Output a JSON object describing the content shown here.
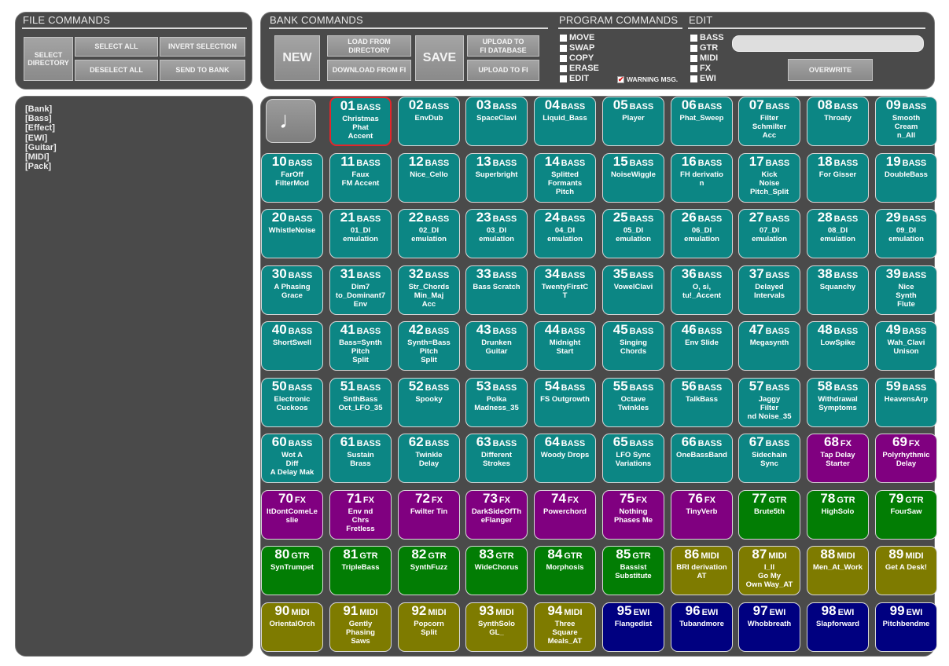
{
  "file_commands": {
    "title": "FILE COMMANDS",
    "select_directory": "SELECT\nDIRECTORY",
    "select_all": "SELECT ALL",
    "invert_selection": "INVERT SELECTION",
    "deselect_all": "DESELECT ALL",
    "send_to_bank": "SEND TO BANK"
  },
  "bank_commands": {
    "title": "BANK COMMANDS",
    "new": "NEW",
    "load_from_directory": "LOAD FROM\nDIRECTORY",
    "download_from_fi": "DOWNLOAD FROM FI",
    "save": "SAVE",
    "upload_to_fi_database": "UPLOAD TO\nFI DATABASE",
    "upload_to_fi": "UPLOAD TO FI"
  },
  "program_commands": {
    "title": "PROGRAM COMMANDS",
    "options": [
      "MOVE",
      "SWAP",
      "COPY",
      "ERASE",
      "EDIT"
    ],
    "warning_label": "WARNING MSG.",
    "warning_checked": true
  },
  "edit": {
    "title": "EDIT",
    "options": [
      "BASS",
      "GTR",
      "MIDI",
      "FX",
      "EWI"
    ],
    "text_value": "",
    "overwrite": "OVERWRITE"
  },
  "categories": [
    "[Bank]",
    "[Bass]",
    "[Effect]",
    "[EWI]",
    "[Guitar]",
    "[MIDI]",
    "[Pack]"
  ],
  "note_icon": "♩",
  "colors": {
    "BASS": "#0c8684",
    "FX": "#800080",
    "GTR": "#027d04",
    "MIDI": "#7e7b00",
    "EWI": "#000080",
    "selected_border": "#e1262b"
  },
  "programs": [
    {
      "num": "01",
      "type": "BASS",
      "name": "Christmas\nPhat\nAccent",
      "selected": true
    },
    {
      "num": "02",
      "type": "BASS",
      "name": "EnvDub"
    },
    {
      "num": "03",
      "type": "BASS",
      "name": "SpaceClavi"
    },
    {
      "num": "04",
      "type": "BASS",
      "name": "Liquid_Bass"
    },
    {
      "num": "05",
      "type": "BASS",
      "name": "Player"
    },
    {
      "num": "06",
      "type": "BASS",
      "name": "Phat_Sweep"
    },
    {
      "num": "07",
      "type": "BASS",
      "name": "Filter\nSchmilter\nAcc"
    },
    {
      "num": "08",
      "type": "BASS",
      "name": "Throaty"
    },
    {
      "num": "09",
      "type": "BASS",
      "name": "Smooth\nCream\nn_All"
    },
    {
      "num": "10",
      "type": "BASS",
      "name": "FarOff\nFilterMod"
    },
    {
      "num": "11",
      "type": "BASS",
      "name": "Faux\nFM Accent"
    },
    {
      "num": "12",
      "type": "BASS",
      "name": "Nice_Cello"
    },
    {
      "num": "13",
      "type": "BASS",
      "name": "Superbright"
    },
    {
      "num": "14",
      "type": "BASS",
      "name": "Splitted\nFormants\nPitch"
    },
    {
      "num": "15",
      "type": "BASS",
      "name": "NoiseWiggle"
    },
    {
      "num": "16",
      "type": "BASS",
      "name": "FH derivatio\nn"
    },
    {
      "num": "17",
      "type": "BASS",
      "name": "Kick\nNoise\nPitch_Split"
    },
    {
      "num": "18",
      "type": "BASS",
      "name": "For Gisser"
    },
    {
      "num": "19",
      "type": "BASS",
      "name": "DoubleBass"
    },
    {
      "num": "20",
      "type": "BASS",
      "name": "WhistleNoise"
    },
    {
      "num": "21",
      "type": "BASS",
      "name": "01_DI\nemulation"
    },
    {
      "num": "22",
      "type": "BASS",
      "name": "02_DI\nemulation"
    },
    {
      "num": "23",
      "type": "BASS",
      "name": "03_DI\nemulation"
    },
    {
      "num": "24",
      "type": "BASS",
      "name": "04_DI\nemulation"
    },
    {
      "num": "25",
      "type": "BASS",
      "name": "05_DI\nemulation"
    },
    {
      "num": "26",
      "type": "BASS",
      "name": "06_DI\nemulation"
    },
    {
      "num": "27",
      "type": "BASS",
      "name": "07_DI\nemulation"
    },
    {
      "num": "28",
      "type": "BASS",
      "name": "08_DI\nemulation"
    },
    {
      "num": "29",
      "type": "BASS",
      "name": "09_DI\nemulation"
    },
    {
      "num": "30",
      "type": "BASS",
      "name": "A Phasing\nGrace"
    },
    {
      "num": "31",
      "type": "BASS",
      "name": "Dim7\nto_Dominant7\nEnv"
    },
    {
      "num": "32",
      "type": "BASS",
      "name": "Str_Chords\nMin_Maj\nAcc"
    },
    {
      "num": "33",
      "type": "BASS",
      "name": "Bass Scratch"
    },
    {
      "num": "34",
      "type": "BASS",
      "name": "TwentyFirstC\nT"
    },
    {
      "num": "35",
      "type": "BASS",
      "name": "VowelClavi"
    },
    {
      "num": "36",
      "type": "BASS",
      "name": "O, si,\ntu!_Accent"
    },
    {
      "num": "37",
      "type": "BASS",
      "name": "Delayed\nIntervals"
    },
    {
      "num": "38",
      "type": "BASS",
      "name": "Squanchy"
    },
    {
      "num": "39",
      "type": "BASS",
      "name": "Nice\nSynth\nFlute"
    },
    {
      "num": "40",
      "type": "BASS",
      "name": "ShortSwell"
    },
    {
      "num": "41",
      "type": "BASS",
      "name": "Bass=Synth\nPitch\nSplit"
    },
    {
      "num": "42",
      "type": "BASS",
      "name": "Synth=Bass\nPitch\nSplit"
    },
    {
      "num": "43",
      "type": "BASS",
      "name": "Drunken\nGuitar"
    },
    {
      "num": "44",
      "type": "BASS",
      "name": "Midnight\nStart"
    },
    {
      "num": "45",
      "type": "BASS",
      "name": "Singing\nChords"
    },
    {
      "num": "46",
      "type": "BASS",
      "name": "Env Slide"
    },
    {
      "num": "47",
      "type": "BASS",
      "name": "Megasynth"
    },
    {
      "num": "48",
      "type": "BASS",
      "name": "LowSpike"
    },
    {
      "num": "49",
      "type": "BASS",
      "name": "Wah_Clavi\nUnison"
    },
    {
      "num": "50",
      "type": "BASS",
      "name": "Electronic\nCuckoos"
    },
    {
      "num": "51",
      "type": "BASS",
      "name": "SnthBass\nOct_LFO_35"
    },
    {
      "num": "52",
      "type": "BASS",
      "name": "Spooky"
    },
    {
      "num": "53",
      "type": "BASS",
      "name": "Polka\nMadness_35"
    },
    {
      "num": "54",
      "type": "BASS",
      "name": "FS Outgrowth"
    },
    {
      "num": "55",
      "type": "BASS",
      "name": "Octave\nTwinkles"
    },
    {
      "num": "56",
      "type": "BASS",
      "name": "TalkBass"
    },
    {
      "num": "57",
      "type": "BASS",
      "name": "Jaggy\nFilter\nnd Noise_35"
    },
    {
      "num": "58",
      "type": "BASS",
      "name": "Withdrawal\nSymptoms"
    },
    {
      "num": "59",
      "type": "BASS",
      "name": "HeavensArp"
    },
    {
      "num": "60",
      "type": "BASS",
      "name": "Wot A\nDiff\nA Delay Mak"
    },
    {
      "num": "61",
      "type": "BASS",
      "name": "Sustain\nBrass"
    },
    {
      "num": "62",
      "type": "BASS",
      "name": "Twinkle\nDelay"
    },
    {
      "num": "63",
      "type": "BASS",
      "name": "Different\nStrokes"
    },
    {
      "num": "64",
      "type": "BASS",
      "name": "Woody Drops"
    },
    {
      "num": "65",
      "type": "BASS",
      "name": "LFO Sync\nVariations"
    },
    {
      "num": "66",
      "type": "BASS",
      "name": "OneBassBand"
    },
    {
      "num": "67",
      "type": "BASS",
      "name": "Sidechain\nSync"
    },
    {
      "num": "68",
      "type": "FX",
      "name": "Tap Delay\nStarter"
    },
    {
      "num": "69",
      "type": "FX",
      "name": "Polyrhythmic\nDelay"
    },
    {
      "num": "70",
      "type": "FX",
      "name": "ItDontComeLe\nslie"
    },
    {
      "num": "71",
      "type": "FX",
      "name": "Env nd\nChrs\nFretless"
    },
    {
      "num": "72",
      "type": "FX",
      "name": "Fwilter Tin"
    },
    {
      "num": "73",
      "type": "FX",
      "name": "DarkSideOfTh\neFlanger"
    },
    {
      "num": "74",
      "type": "FX",
      "name": "Powerchord"
    },
    {
      "num": "75",
      "type": "FX",
      "name": "Nothing\nPhases Me"
    },
    {
      "num": "76",
      "type": "FX",
      "name": "TinyVerb"
    },
    {
      "num": "77",
      "type": "GTR",
      "name": "Brute5th"
    },
    {
      "num": "78",
      "type": "GTR",
      "name": "HighSolo"
    },
    {
      "num": "79",
      "type": "GTR",
      "name": "FourSaw"
    },
    {
      "num": "80",
      "type": "GTR",
      "name": "SynTrumpet"
    },
    {
      "num": "81",
      "type": "GTR",
      "name": "TripleBass"
    },
    {
      "num": "82",
      "type": "GTR",
      "name": "SynthFuzz"
    },
    {
      "num": "83",
      "type": "GTR",
      "name": "WideChorus"
    },
    {
      "num": "84",
      "type": "GTR",
      "name": "Morphosis"
    },
    {
      "num": "85",
      "type": "GTR",
      "name": "Bassist\nSubstitute"
    },
    {
      "num": "86",
      "type": "MIDI",
      "name": "BRI derivation\nAT"
    },
    {
      "num": "87",
      "type": "MIDI",
      "name": "I_II\nGo My\nOwn Way_AT"
    },
    {
      "num": "88",
      "type": "MIDI",
      "name": "Men_At_Work"
    },
    {
      "num": "89",
      "type": "MIDI",
      "name": "Get A Desk!"
    },
    {
      "num": "90",
      "type": "MIDI",
      "name": "OrientalOrch"
    },
    {
      "num": "91",
      "type": "MIDI",
      "name": "Gently\nPhasing\nSaws"
    },
    {
      "num": "92",
      "type": "MIDI",
      "name": "Popcorn\nSplit"
    },
    {
      "num": "93",
      "type": "MIDI",
      "name": "SynthSolo\nGL_"
    },
    {
      "num": "94",
      "type": "MIDI",
      "name": "Three\nSquare\nMeals_AT"
    },
    {
      "num": "95",
      "type": "EWI",
      "name": "Flangedist"
    },
    {
      "num": "96",
      "type": "EWI",
      "name": "Tubandmore"
    },
    {
      "num": "97",
      "type": "EWI",
      "name": "Whobbreath"
    },
    {
      "num": "98",
      "type": "EWI",
      "name": "Slapforward"
    },
    {
      "num": "99",
      "type": "EWI",
      "name": "Pitchbendme"
    }
  ]
}
